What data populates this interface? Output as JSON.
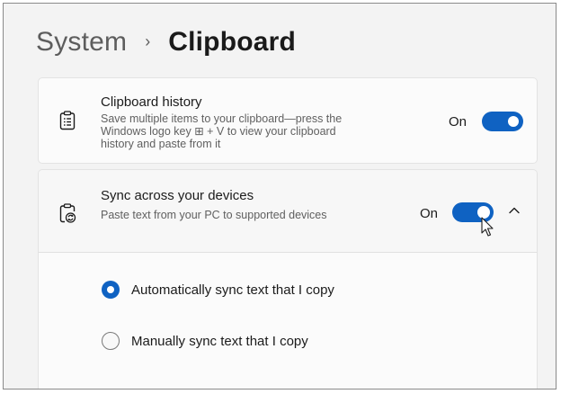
{
  "breadcrumb": {
    "parent": "System",
    "separator": "›",
    "current": "Clipboard"
  },
  "clipboard_history": {
    "icon": "clipboard-list-icon",
    "title": "Clipboard history",
    "description": "Save multiple items to your clipboard—press the Windows logo key ⊞ + V to view your clipboard history and paste from it",
    "state": "On"
  },
  "sync_devices": {
    "icon": "clipboard-sync-icon",
    "title": "Sync across your devices",
    "description": "Paste text from your PC to supported devices",
    "state": "On",
    "expanded": true
  },
  "sync_options": [
    {
      "label": "Automatically sync text that I copy",
      "selected": true
    },
    {
      "label": "Manually sync text that I copy",
      "selected": false
    }
  ],
  "colors": {
    "accent": "#0f62c2",
    "background": "#f3f3f3",
    "card": "#fbfbfb"
  }
}
